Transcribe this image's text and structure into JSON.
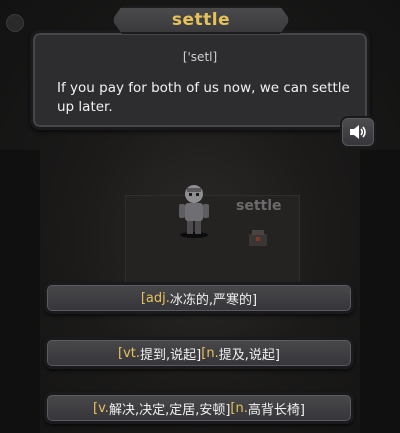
{
  "word": "settle",
  "phonetic": "['setl]",
  "example_sentence": "If you pay for both of us now, we can settle up later.",
  "floating_word": "settle",
  "options": [
    {
      "pos1": "[adj.",
      "def1": " 冰冻的,严寒的]",
      "pos2": "",
      "def2": ""
    },
    {
      "pos1": "[vt.",
      "def1": " 提到,说起]",
      "pos2": "[n.",
      "def2": " 提及,说起]"
    },
    {
      "pos1": "[v.",
      "def1": " 解决,决定,定居,安顿]",
      "pos2": "[n.",
      "def2": " 高背长椅]"
    }
  ],
  "colors": {
    "accent": "#e6c25a",
    "panel": "#2d2d30",
    "border": "#1a1a1c"
  },
  "icons": {
    "speaker": "speaker-icon"
  }
}
